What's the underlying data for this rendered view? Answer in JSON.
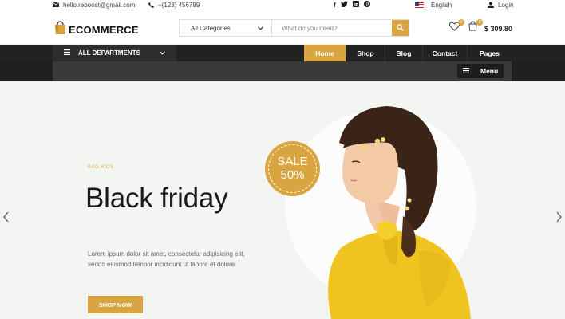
{
  "topbar": {
    "email": "hello.reboost@gmail.com",
    "phone": "+(123) 456789",
    "social": [
      "facebook-icon",
      "twitter-icon",
      "linkedin-icon",
      "pinterest-icon"
    ],
    "language": "English",
    "login": "Login"
  },
  "header": {
    "logo": "ECOMMERCE",
    "category": "All Categories",
    "search_placeholder": "What do you need?",
    "wishlist_count": "0",
    "cart_count": "0",
    "cart_total": "$ 309.80"
  },
  "nav": {
    "departments": "ALL DEPARTMENTS",
    "links": [
      "Home",
      "Shop",
      "Blog",
      "Contact",
      "Pages"
    ],
    "menu": "Menu"
  },
  "hero": {
    "kicker": "BAG,KIDS",
    "headline": "Black friday",
    "description_line1": "Lorem ipsum dolor sit amet, consectetur adipisicing elit,",
    "description_line2": "seddo eiusmod tempor incididunt ut labore et dolore",
    "button": "SHOP NOW",
    "sale_line1": "SALE",
    "sale_line2": "50%"
  },
  "colors": {
    "accent": "#d9a541",
    "nav_bg": "#222222",
    "hero_bg": "#f2f5f1"
  }
}
